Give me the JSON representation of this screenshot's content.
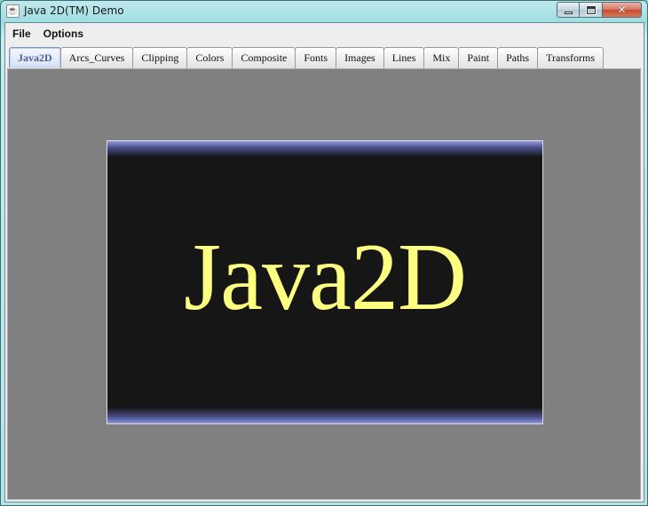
{
  "window": {
    "title": "Java 2D(TM) Demo",
    "icon": "java-cup-icon",
    "controls": {
      "minimize": "minimize-icon",
      "maximize": "maximize-icon",
      "close": "close-icon",
      "close_glyph": "✕"
    }
  },
  "menubar": {
    "items": [
      "File",
      "Options"
    ]
  },
  "tabs": [
    "Java2D",
    "Arcs_Curves",
    "Clipping",
    "Colors",
    "Composite",
    "Fonts",
    "Images",
    "Lines",
    "Mix",
    "Paint",
    "Paths",
    "Transforms"
  ],
  "selected_tab": "Java2D",
  "demo": {
    "banner_text": "Java2D"
  },
  "colors": {
    "content_background": "#808080",
    "panel_background": "#161616",
    "banner_text": "#ffff80",
    "panel_gradient_edge": "#8f98e4",
    "active_tab_text": "#4a5e96"
  }
}
